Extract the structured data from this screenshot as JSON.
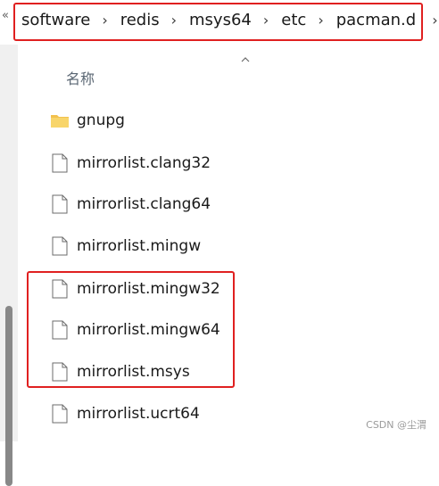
{
  "breadcrumb": {
    "overflow": "«",
    "items": [
      "software",
      "redis",
      "msys64",
      "etc",
      "pacman.d"
    ],
    "separator": "›"
  },
  "header": {
    "name_column": "名称"
  },
  "files": [
    {
      "name": "gnupg",
      "type": "folder"
    },
    {
      "name": "mirrorlist.clang32",
      "type": "file"
    },
    {
      "name": "mirrorlist.clang64",
      "type": "file"
    },
    {
      "name": "mirrorlist.mingw",
      "type": "file"
    },
    {
      "name": "mirrorlist.mingw32",
      "type": "file"
    },
    {
      "name": "mirrorlist.mingw64",
      "type": "file"
    },
    {
      "name": "mirrorlist.msys",
      "type": "file"
    },
    {
      "name": "mirrorlist.ucrt64",
      "type": "file"
    }
  ],
  "watermark": "CSDN @尘渭",
  "colors": {
    "highlight": "#e02020",
    "folder": "#f2c14e",
    "scroll_thumb": "#888888"
  },
  "icons": {
    "folder": "folder-icon",
    "file": "file-icon",
    "sort": "sort-up-icon",
    "separator": "chevron-right-icon"
  }
}
